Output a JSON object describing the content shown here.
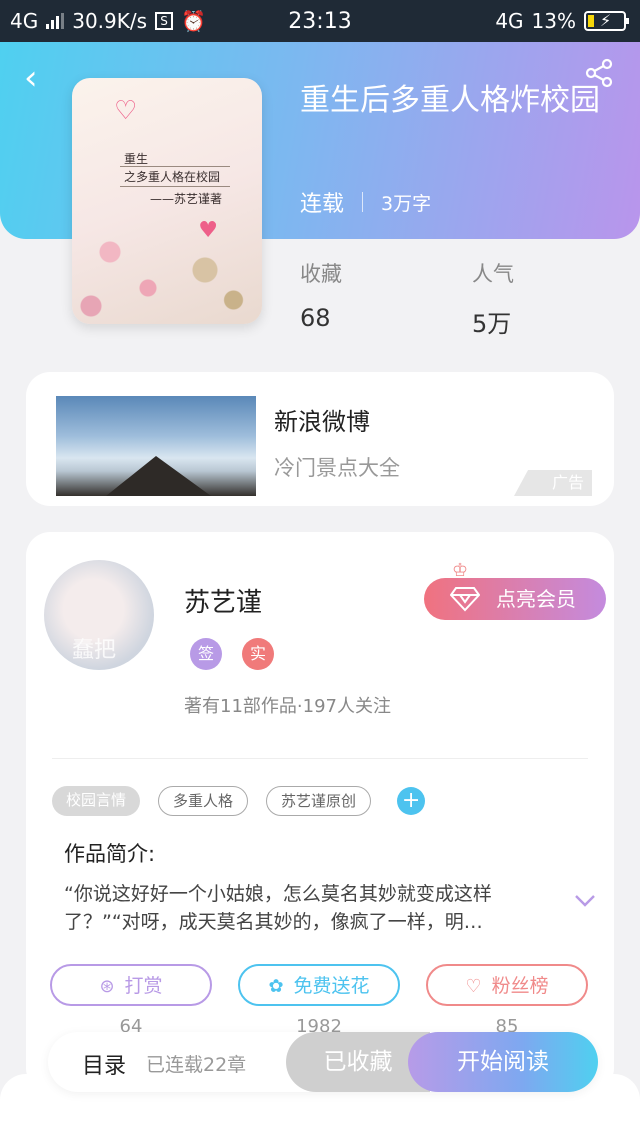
{
  "status_bar": {
    "network": "4G",
    "speed": "30.9K/s",
    "s_icon": "S",
    "time": "23:13",
    "network_right": "4G",
    "battery": "13%"
  },
  "book": {
    "title": "重生后多重人格炸校园",
    "status": "连载",
    "word_count": "3万字",
    "cover_line1": "重生",
    "cover_line2": "之多重人格在校园",
    "cover_line3": "——苏艺谨著"
  },
  "stats": [
    {
      "label": "收藏",
      "value": "68"
    },
    {
      "label": "人气",
      "value": "5万"
    }
  ],
  "ad": {
    "name": "新浪微博",
    "subtitle": "冷门景点大全",
    "tag": "广告"
  },
  "author": {
    "name": "苏艺谨",
    "badge_sign": "签",
    "badge_real": "实",
    "summary": "著有11部作品·197人关注",
    "avatar_watermark": "蠢把",
    "vip_label": "点亮会员"
  },
  "tags": [
    "校园言情",
    "多重人格",
    "苏艺谨原创"
  ],
  "intro": {
    "heading": "作品简介:",
    "text": "“你说这好好一个小姑娘，怎么莫名其妙就变成这样了？”“对呀，成天莫名其妙的，像疯了一样，明…"
  },
  "actions": [
    {
      "label": "打赏",
      "count": "64",
      "color": "#b89ae6"
    },
    {
      "label": "免费送花",
      "count": "1982",
      "color": "#4dc3ef"
    },
    {
      "label": "粉丝榜",
      "count": "85",
      "color": "#f08a8a"
    }
  ],
  "bottom": {
    "toc": "目录",
    "chapters": "已连载22章",
    "collected": "已收藏",
    "start_reading": "开始阅读"
  }
}
